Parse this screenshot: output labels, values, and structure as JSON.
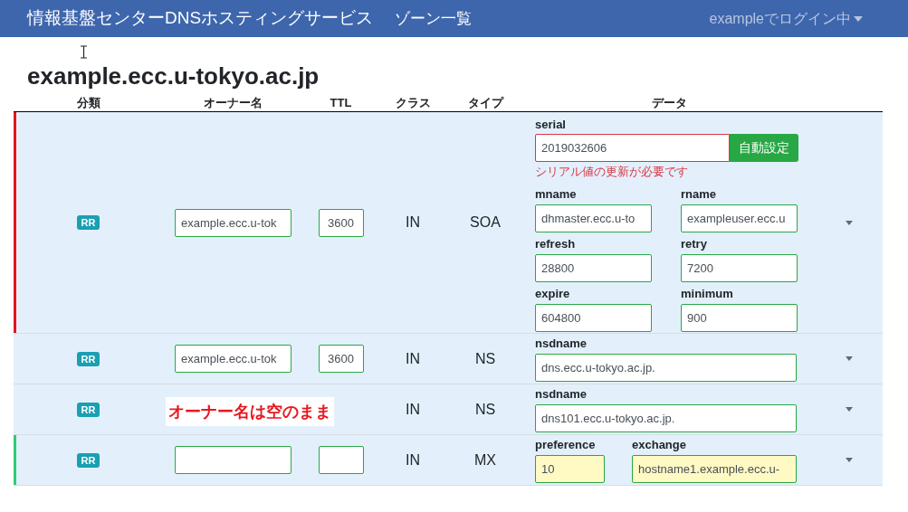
{
  "navbar": {
    "brand": "情報基盤センターDNSホスティングサービス",
    "links": [
      "ゾーン一覧"
    ],
    "user": "exampleでログイン中"
  },
  "zone_title": "example.ecc.u-tokyo.ac.jp",
  "table": {
    "columns": [
      "分類",
      "オーナー名",
      "TTL",
      "クラス",
      "タイプ",
      "データ"
    ],
    "rows": [
      {
        "color": "#e3161e",
        "badge": "RR",
        "owner": {
          "value": "example.ecc.u-tok"
        },
        "ttl": {
          "value": "3600"
        },
        "class": "IN",
        "type": "SOA",
        "kind": "soa",
        "serial": {
          "label": "serial",
          "value": "2019032606",
          "invalid": true,
          "button": "自動設定",
          "error": "シリアル値の更新が必要です"
        },
        "fields": [
          {
            "label": "mname",
            "value": "dhmaster.ecc.u-to",
            "highlighted": false
          },
          {
            "label": "rname",
            "value": "exampleuser.ecc.u",
            "highlighted": false
          },
          {
            "label": "refresh",
            "value": "28800",
            "highlighted": false
          },
          {
            "label": "retry",
            "value": "7200",
            "highlighted": false
          },
          {
            "label": "expire",
            "value": "604800",
            "highlighted": false
          },
          {
            "label": "minimum",
            "value": "900",
            "highlighted": false
          }
        ]
      },
      {
        "badge": "RR",
        "owner": {
          "value": "example.ecc.u-tok"
        },
        "ttl": {
          "value": "3600"
        },
        "class": "IN",
        "type": "NS",
        "kind": "single",
        "fields": [
          {
            "label": "nsdname",
            "value": "dns.ecc.u-tokyo.ac.jp.",
            "highlighted": false
          }
        ]
      },
      {
        "badge": "RR",
        "class": "IN",
        "type": "NS",
        "kind": "single",
        "annotation": "オーナー名は空のまま",
        "fields": [
          {
            "label": "nsdname",
            "value": "dns101.ecc.u-tokyo.ac.jp.",
            "highlighted": false
          }
        ]
      },
      {
        "color": "#2ecc71",
        "badge": "RR",
        "owner": {},
        "ttl": {},
        "class": "IN",
        "type": "MX",
        "kind": "pair",
        "fields": [
          {
            "label": "preference",
            "value": "10",
            "highlighted": true
          },
          {
            "label": "exchange",
            "value": "hostname1.example.ecc.u-",
            "highlighted": true
          }
        ]
      }
    ]
  }
}
